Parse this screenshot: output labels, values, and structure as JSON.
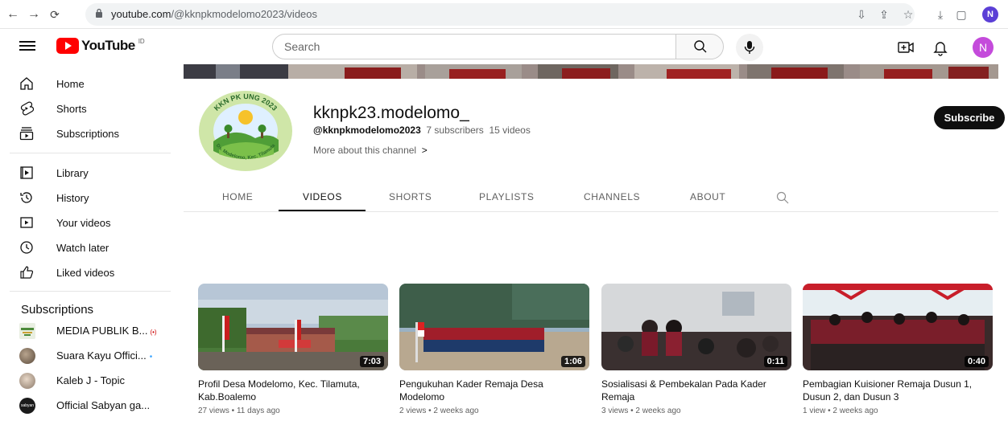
{
  "browser": {
    "url_host": "youtube.com",
    "url_path": "/@kknpkmodelomo2023/videos",
    "profile_initial": "N"
  },
  "header": {
    "logo_text": "YouTube",
    "logo_sup": "ID",
    "search_placeholder": "Search",
    "avatar_initial": "N"
  },
  "sidebar": {
    "main": [
      {
        "label": "Home",
        "icon": "home-icon"
      },
      {
        "label": "Shorts",
        "icon": "shorts-icon"
      },
      {
        "label": "Subscriptions",
        "icon": "subscriptions-icon"
      }
    ],
    "library": [
      {
        "label": "Library",
        "icon": "library-icon"
      },
      {
        "label": "History",
        "icon": "history-icon"
      },
      {
        "label": "Your videos",
        "icon": "your-videos-icon"
      },
      {
        "label": "Watch later",
        "icon": "watch-later-icon"
      },
      {
        "label": "Liked videos",
        "icon": "liked-videos-icon"
      }
    ],
    "subscriptions_heading": "Subscriptions",
    "subscriptions": [
      {
        "label": "MEDIA PUBLIK B...",
        "badge": "(•)",
        "color": "#6b8e4e"
      },
      {
        "label": "Suara Kayu Offici...",
        "badge": "•",
        "color": "#7a6a58"
      },
      {
        "label": "Kaleb J - Topic",
        "badge": "",
        "color": "#9b8a7a"
      },
      {
        "label": "Official Sabyan ga...",
        "badge": "",
        "color": "#1a1a1a"
      }
    ]
  },
  "channel": {
    "name": "kknpk23.modelomo_",
    "handle": "@kknpkmodelomo2023",
    "subscribers": "7 subscribers",
    "videos_count": "15 videos",
    "more_link": "More about this channel",
    "subscribe_label": "Subscribe",
    "logo_text_top": "KKN PK UNG 2023",
    "logo_text_bottom": "Ds. Modelomo, Kec. Tilamuta"
  },
  "tabs": [
    "HOME",
    "VIDEOS",
    "SHORTS",
    "PLAYLISTS",
    "CHANNELS",
    "ABOUT"
  ],
  "active_tab": "VIDEOS",
  "videos": [
    {
      "title": "Profil Desa Modelomo, Kec. Tilamuta, Kab.Boalemo",
      "duration": "7:03",
      "views": "27 views",
      "age": "11 days ago"
    },
    {
      "title": "Pengukuhan Kader Remaja Desa Modelomo",
      "duration": "1:06",
      "views": "2 views",
      "age": "2 weeks ago"
    },
    {
      "title": "Sosialisasi & Pembekalan Pada Kader Remaja",
      "duration": "0:11",
      "views": "3 views",
      "age": "2 weeks ago"
    },
    {
      "title": "Pembagian Kuisioner Remaja Dusun 1, Dusun 2, dan Dusun 3",
      "duration": "0:40",
      "views": "1 view",
      "age": "2 weeks ago"
    }
  ],
  "colors": {
    "brand_red": "#ff0000",
    "text": "#0f0f0f",
    "muted": "#606060"
  }
}
